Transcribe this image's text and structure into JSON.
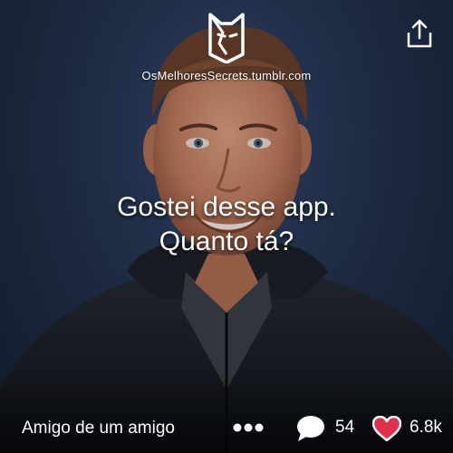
{
  "brand": {
    "logo_icon": "fox-mask-icon",
    "url": "OsMelhoresSecrets.tumblr.com"
  },
  "share": {
    "icon": "share-upload-icon"
  },
  "message": {
    "line1": "Gostei desse app.",
    "line2": "Quanto tá?"
  },
  "footer": {
    "origin": "Amigo de um amigo",
    "more_icon": "more-dots-icon",
    "comment_icon": "comment-bubble-icon",
    "comment_count": "54",
    "like_icon": "heart-icon",
    "like_count": "6.8k"
  },
  "colors": {
    "background": "#22314d",
    "text": "#ffffff",
    "heart": "#e0314b"
  }
}
